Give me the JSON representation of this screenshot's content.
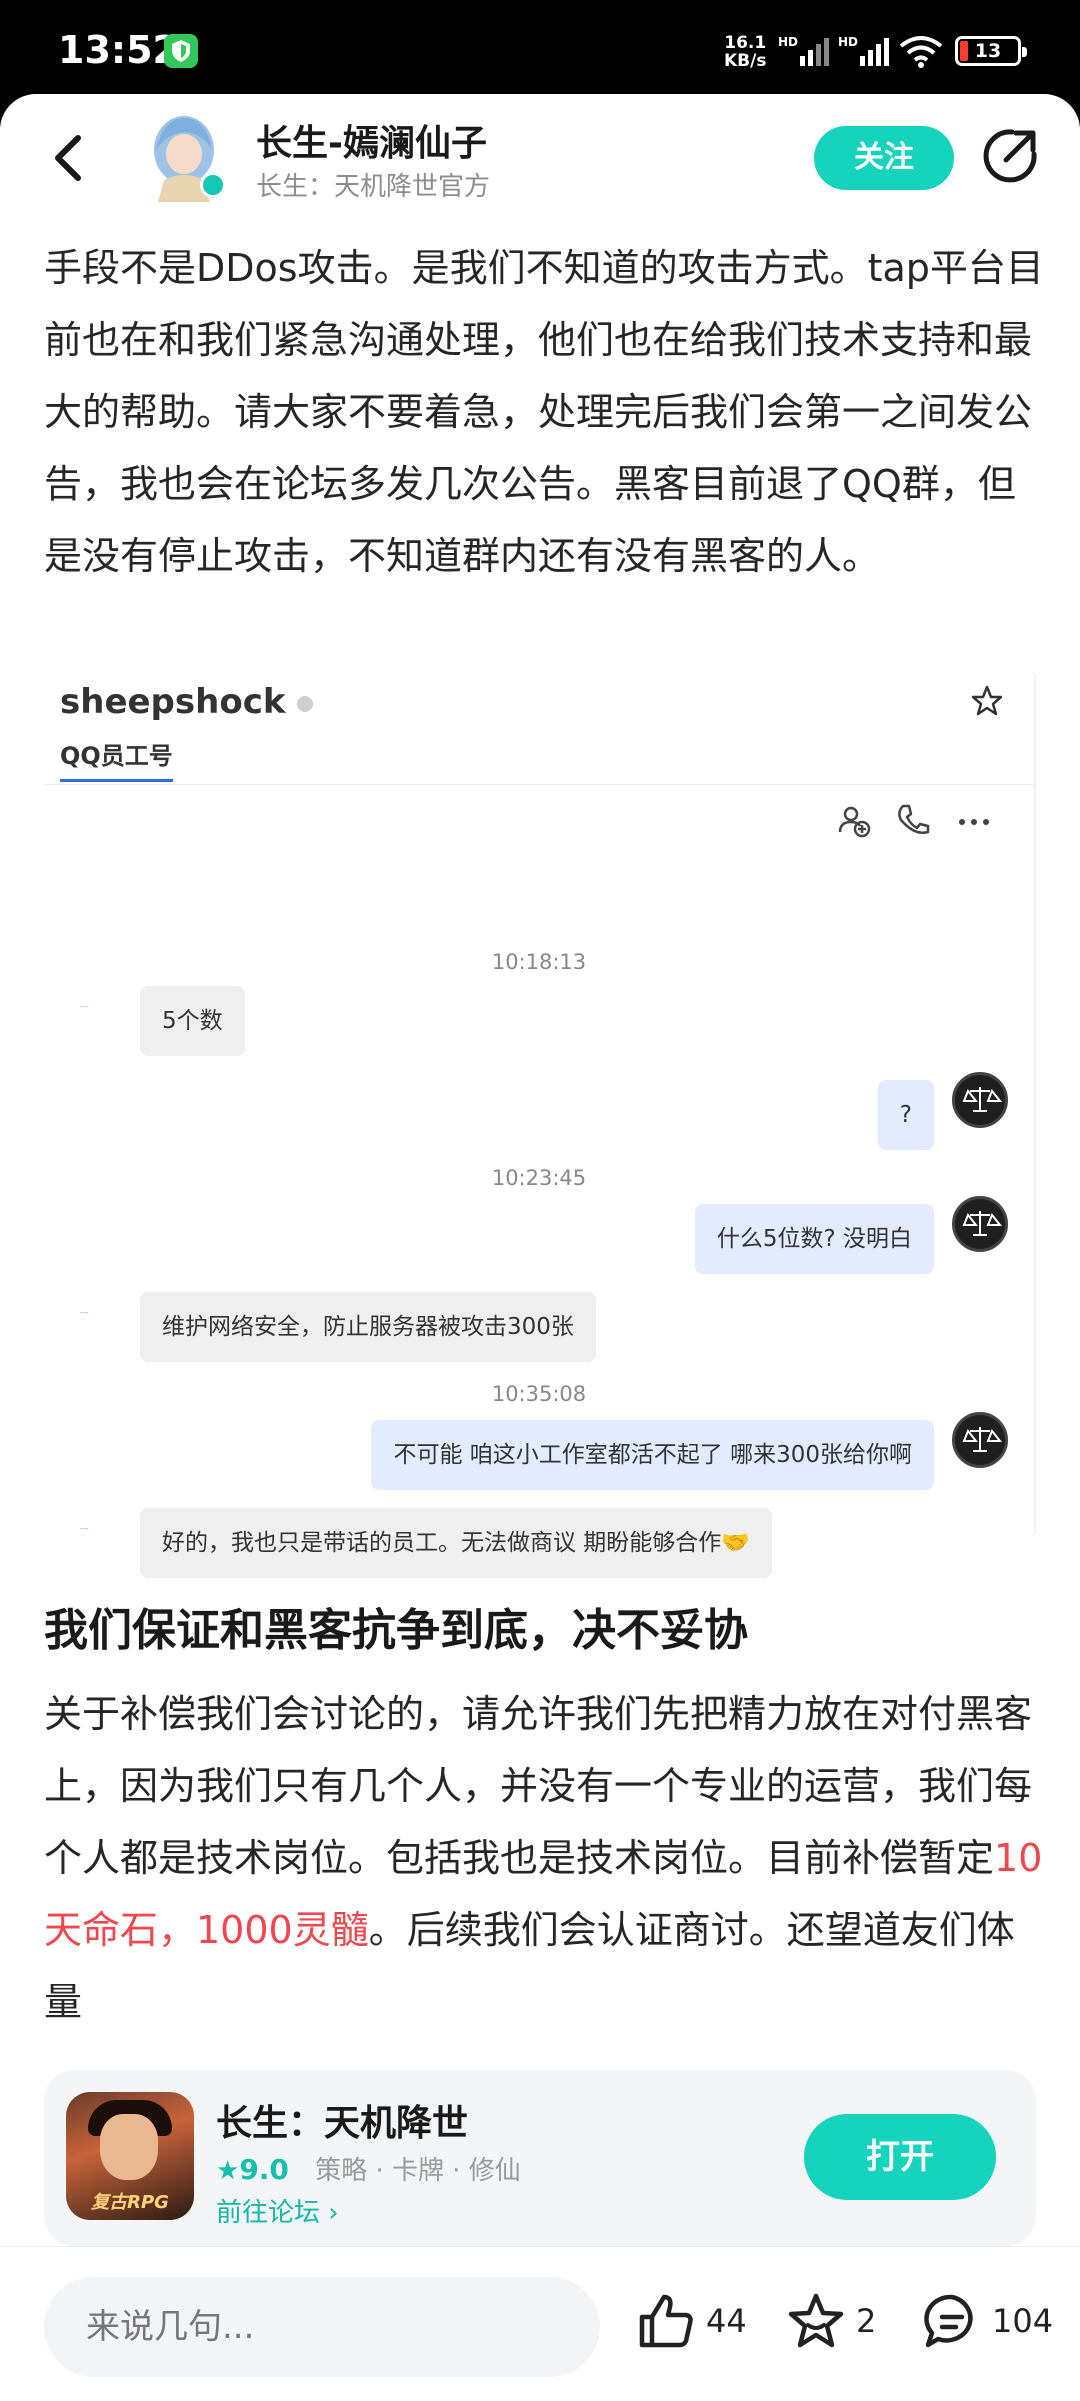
{
  "status_bar": {
    "time": "13:52",
    "net_speed_value": "16.1",
    "net_speed_unit": "KB/s",
    "sim1": "HD",
    "sim2": "HD",
    "battery": "13"
  },
  "header": {
    "author_name": "长生-嫣澜仙子",
    "author_sub": "长生：天机降世官方",
    "follow_label": "关注"
  },
  "post": {
    "para1": "手段不是DDos攻击。是我们不知道的攻击方式。tap平台目前也在和我们紧急沟通处理，他们也在给我们技术支持和最大的帮助。请大家不要着急，处理完后我们会第一之间发公告，我也会在论坛多发几次公告。黑客目前退了QQ群，但是没有停止攻击，不知道群内还有没有黑客的人。",
    "heading": "我们保证和黑客抗争到底，决不妥协",
    "para2_a": "关于补偿我们会讨论的，请允许我们先把精力放在对付黑客上，因为我们只有几个人，并没有一个专业的运营，我们每个人都是技术岗位。包括我也是技术岗位。目前补偿暂定",
    "para2_highlight": "10天命石，1000灵髓",
    "para2_b": "。后续我们会认证商讨。还望道友们体量"
  },
  "chat_screenshot": {
    "contact": "sheepshock",
    "tab": "QQ员工号",
    "sender_label": "---",
    "messages": [
      {
        "time": "10:18:13"
      },
      {
        "side": "left",
        "text": "5个数"
      },
      {
        "side": "right",
        "text": "?"
      },
      {
        "time": "10:23:45"
      },
      {
        "side": "right",
        "text": "什么5位数?   没明白"
      },
      {
        "side": "left",
        "text": "维护网络安全，防止服务器被攻击300张"
      },
      {
        "time": "10:35:08"
      },
      {
        "side": "right",
        "text": "不可能    咱这小工作室都活不起了  哪来300张给你啊"
      },
      {
        "side": "left",
        "text": "好的，我也只是带话的员工。无法做商议 期盼能够合作🤝"
      }
    ]
  },
  "game_card": {
    "name": "长生：天机降世",
    "score": "9.0",
    "tags": "策略 · 卡牌 · 修仙",
    "icon_label": "复古RPG",
    "forum_link": "前往论坛",
    "open_label": "打开"
  },
  "bottom_bar": {
    "comment_placeholder": "来说几句...",
    "likes": "44",
    "favorites": "2",
    "comments": "104"
  },
  "colors": {
    "accent": "#15d3bd",
    "highlight": "#f0474e"
  }
}
